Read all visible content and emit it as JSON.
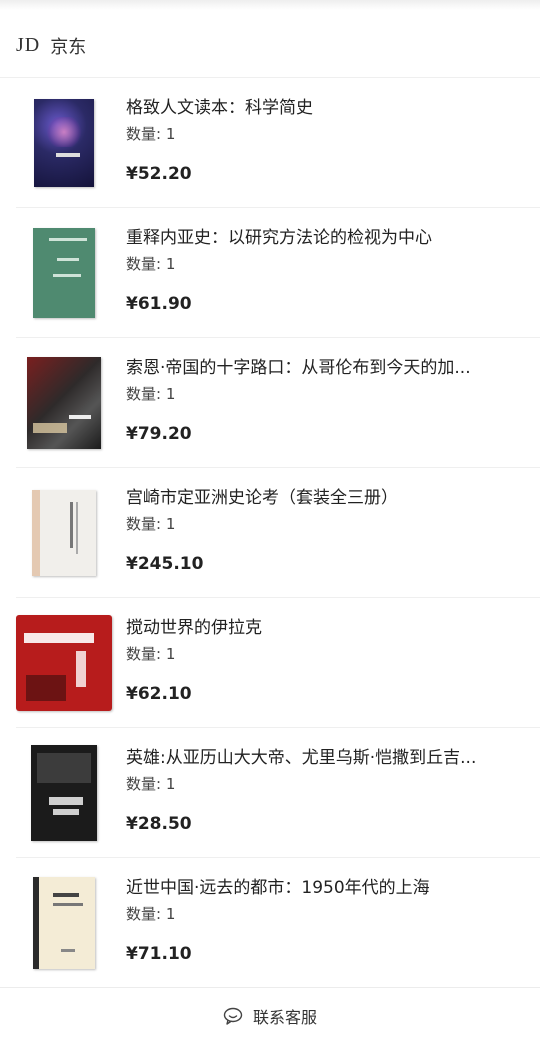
{
  "store": {
    "logo": "JD",
    "name": "京东"
  },
  "items": [
    {
      "title": "格致人文读本：科学简史",
      "qty_label": "数量: ",
      "qty": "1",
      "price": "¥52.20"
    },
    {
      "title": "重释内亚史：以研究方法论的检视为中心",
      "qty_label": "数量: ",
      "qty": "1",
      "price": "¥61.90"
    },
    {
      "title": "索恩·帝国的十字路口：从哥伦布到今天的加...",
      "qty_label": "数量: ",
      "qty": "1",
      "price": "¥79.20"
    },
    {
      "title": "宫崎市定亚洲史论考（套装全三册）",
      "qty_label": "数量: ",
      "qty": "1",
      "price": "¥245.10"
    },
    {
      "title": "搅动世界的伊拉克",
      "qty_label": "数量: ",
      "qty": "1",
      "price": "¥62.10"
    },
    {
      "title": "英雄:从亚历山大大帝、尤里乌斯·恺撒到丘吉...",
      "qty_label": "数量: ",
      "qty": "1",
      "price": "¥28.50"
    },
    {
      "title": "近世中国·远去的都市：1950年代的上海",
      "qty_label": "数量: ",
      "qty": "1",
      "price": "¥71.10"
    }
  ],
  "footer": {
    "service_label": "联系客服",
    "icon": "chat-bubble-icon"
  }
}
